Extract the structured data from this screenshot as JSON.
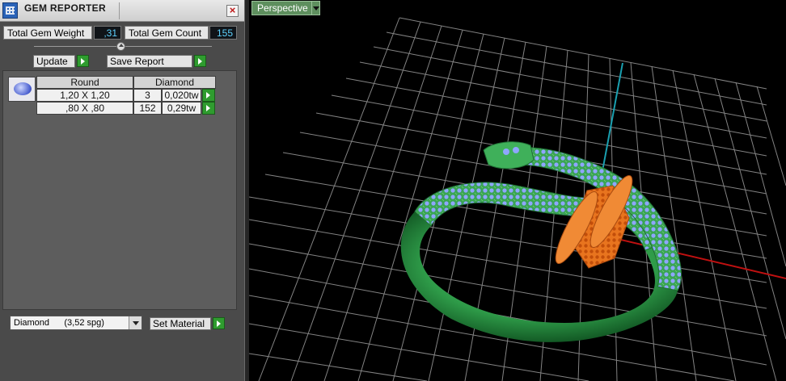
{
  "panel": {
    "title": "GEM REPORTER",
    "close_label": "×",
    "total_weight_label": "Total Gem Weight",
    "total_weight_value": ",31",
    "total_count_label": "Total Gem Count",
    "total_count_value": "155",
    "update_label": "Update",
    "save_report_label": "Save Report",
    "table": {
      "headers": [
        "Round",
        "Diamond"
      ],
      "rows": [
        {
          "size": "1,20 X 1,20",
          "count": "3",
          "weight": "0,020tw"
        },
        {
          "size": ",80 X ,80",
          "count": "152",
          "weight": "0,29tw"
        }
      ]
    },
    "material_select": "Diamond      (3,52 spg)",
    "set_material_label": "Set Material"
  },
  "viewport": {
    "view_label": "Perspective"
  },
  "colors": {
    "grid": "#9a9a9a",
    "ring": "#2e9a48",
    "gems": "#8fa6ff",
    "orange": "#e8741e",
    "axis_x": "#c01010",
    "axis_y": "#1aa0b0"
  }
}
